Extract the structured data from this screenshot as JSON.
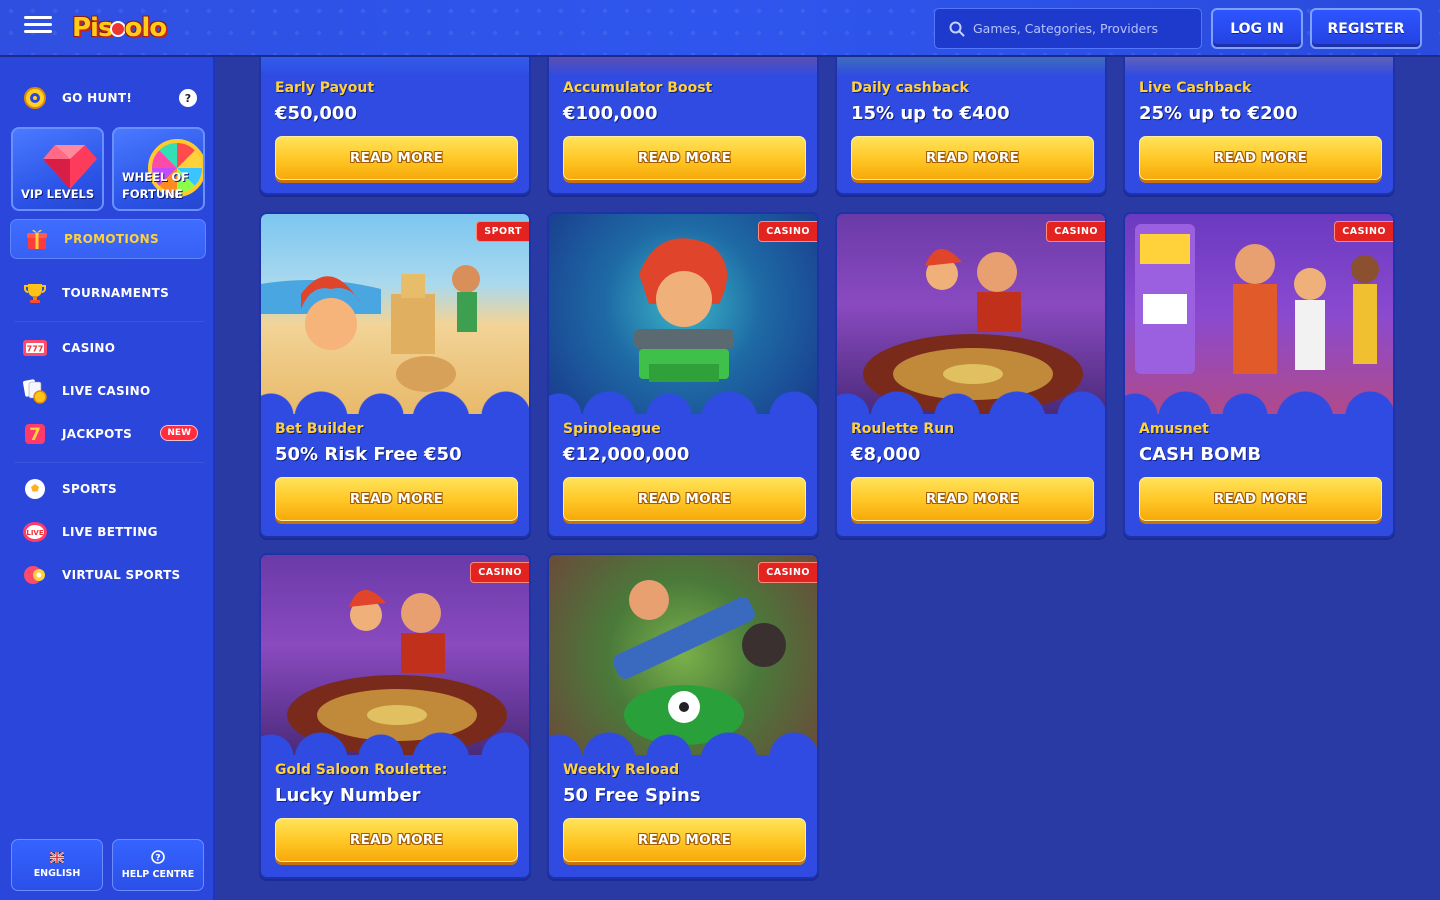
{
  "header": {
    "logo_text": "PISTOLO",
    "search_placeholder": "Games, Categories, Providers",
    "login_label": "LOG IN",
    "register_label": "REGISTER"
  },
  "sidebar": {
    "go_hunt_label": "GO HUNT!",
    "go_hunt_help": "?",
    "vip_label_1": "VIP LEVELS",
    "wheel_label_1": "WHEEL OF",
    "wheel_label_2": "FORTUNE",
    "items": [
      {
        "label": "PROMOTIONS",
        "icon": "gift-icon"
      },
      {
        "label": "TOURNAMENTS",
        "icon": "trophy-icon"
      },
      {
        "label": "CASINO",
        "icon": "slot-777-icon"
      },
      {
        "label": "LIVE CASINO",
        "icon": "cards-chip-icon"
      },
      {
        "label": "JACKPOTS",
        "icon": "lucky-seven-icon",
        "badge": "NEW"
      },
      {
        "label": "SPORTS",
        "icon": "soccer-ball-icon"
      },
      {
        "label": "LIVE BETTING",
        "icon": "live-icon"
      },
      {
        "label": "VIRTUAL SPORTS",
        "icon": "virtual-ball-icon"
      }
    ],
    "language_label": "ENGLISH",
    "help_label": "HELP CENTRE"
  },
  "cards": [
    {
      "subtitle": "Early Payout",
      "title": "€50,000",
      "tag": "",
      "button": "READ MORE"
    },
    {
      "subtitle": "Accumulator Boost",
      "title": "€100,000",
      "tag": "",
      "button": "READ MORE"
    },
    {
      "subtitle": "Daily cashback",
      "title": "15% up to €400",
      "tag": "",
      "button": "READ MORE"
    },
    {
      "subtitle": "Live Cashback",
      "title": "25% up to €200",
      "tag": "",
      "button": "READ MORE"
    },
    {
      "subtitle": "Bet Builder",
      "title": "50% Risk Free €50",
      "tag": "SPORT",
      "button": "READ MORE"
    },
    {
      "subtitle": "Spinoleague",
      "title": "€12,000,000",
      "tag": "CASINO",
      "button": "READ MORE"
    },
    {
      "subtitle": "Roulette Run",
      "title": "€8,000",
      "tag": "CASINO",
      "button": "READ MORE"
    },
    {
      "subtitle": "Amusnet",
      "title": "CASH BOMB",
      "tag": "CASINO",
      "button": "READ MORE"
    },
    {
      "subtitle": "Gold Saloon Roulette:",
      "title": "Lucky Number",
      "tag": "CASINO",
      "button": "READ MORE"
    },
    {
      "subtitle": "Weekly Reload",
      "title": "50 Free Spins",
      "tag": "CASINO",
      "button": "READ MORE"
    }
  ],
  "colors": {
    "background": "#2a3aa5",
    "header": "#2e56ee",
    "sidebar": "#2b46db",
    "card": "#2f4be2",
    "accent_yellow": "#ffd23b",
    "tag_red": "#e3231f"
  }
}
